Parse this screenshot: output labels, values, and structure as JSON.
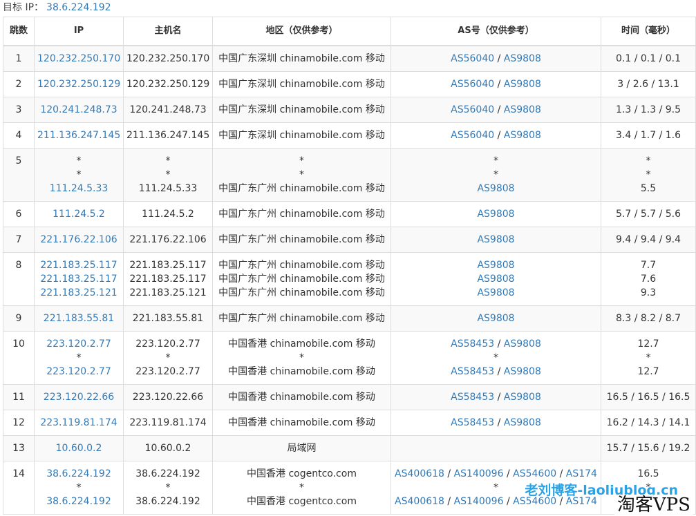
{
  "target": {
    "label": "目标 IP：",
    "ip": "38.6.224.192"
  },
  "headers": [
    "跳数",
    "IP",
    "主机名",
    "地区（仅供参考）",
    "AS号（仅供参考）",
    "时间（毫秒）"
  ],
  "rows": [
    {
      "hop": "1",
      "entries": [
        {
          "ip": "120.232.250.170",
          "host": "120.232.250.170",
          "region": "中国广东深圳 chinamobile.com 移动",
          "as": [
            "AS56040",
            "AS9808"
          ],
          "time": "0.1 / 0.1 / 0.1"
        }
      ]
    },
    {
      "hop": "2",
      "entries": [
        {
          "ip": "120.232.250.129",
          "host": "120.232.250.129",
          "region": "中国广东深圳 chinamobile.com 移动",
          "as": [
            "AS56040",
            "AS9808"
          ],
          "time": "3 / 2.6 / 13.1"
        }
      ]
    },
    {
      "hop": "3",
      "entries": [
        {
          "ip": "120.241.248.73",
          "host": "120.241.248.73",
          "region": "中国广东深圳 chinamobile.com 移动",
          "as": [
            "AS56040",
            "AS9808"
          ],
          "time": "1.3 / 1.3 / 9.5"
        }
      ]
    },
    {
      "hop": "4",
      "entries": [
        {
          "ip": "211.136.247.145",
          "host": "211.136.247.145",
          "region": "中国广东深圳 chinamobile.com 移动",
          "as": [
            "AS56040",
            "AS9808"
          ],
          "time": "3.4 / 1.7 / 1.6"
        }
      ]
    },
    {
      "hop": "5",
      "entries": [
        {
          "ip": "*",
          "host": "*",
          "region": "*",
          "as": [
            "*"
          ],
          "time": "*"
        },
        {
          "ip": "*",
          "host": "*",
          "region": "*",
          "as": [
            "*"
          ],
          "time": "*"
        },
        {
          "ip": "111.24.5.33",
          "host": "111.24.5.33",
          "region": "中国广东广州 chinamobile.com 移动",
          "as": [
            "AS9808"
          ],
          "time": "5.5"
        }
      ]
    },
    {
      "hop": "6",
      "entries": [
        {
          "ip": "111.24.5.2",
          "host": "111.24.5.2",
          "region": "中国广东广州 chinamobile.com 移动",
          "as": [
            "AS9808"
          ],
          "time": "5.7 / 5.7 / 5.6"
        }
      ]
    },
    {
      "hop": "7",
      "entries": [
        {
          "ip": "221.176.22.106",
          "host": "221.176.22.106",
          "region": "中国广东广州 chinamobile.com 移动",
          "as": [
            "AS9808"
          ],
          "time": "9.4 / 9.4 / 9.4"
        }
      ]
    },
    {
      "hop": "8",
      "entries": [
        {
          "ip": "221.183.25.117",
          "host": "221.183.25.117",
          "region": "中国广东广州 chinamobile.com 移动",
          "as": [
            "AS9808"
          ],
          "time": "7.7"
        },
        {
          "ip": "221.183.25.117",
          "host": "221.183.25.117",
          "region": "中国广东广州 chinamobile.com 移动",
          "as": [
            "AS9808"
          ],
          "time": "7.6"
        },
        {
          "ip": "221.183.25.121",
          "host": "221.183.25.121",
          "region": "中国广东广州 chinamobile.com 移动",
          "as": [
            "AS9808"
          ],
          "time": "9.3"
        }
      ]
    },
    {
      "hop": "9",
      "entries": [
        {
          "ip": "221.183.55.81",
          "host": "221.183.55.81",
          "region": "中国广东广州 chinamobile.com 移动",
          "as": [
            "AS9808"
          ],
          "time": "8.3 / 8.2 / 8.7"
        }
      ]
    },
    {
      "hop": "10",
      "entries": [
        {
          "ip": "223.120.2.77",
          "host": "223.120.2.77",
          "region": "中国香港 chinamobile.com 移动",
          "as": [
            "AS58453",
            "AS9808"
          ],
          "time": "12.7"
        },
        {
          "ip": "*",
          "host": "*",
          "region": "*",
          "as": [
            "*"
          ],
          "time": "*"
        },
        {
          "ip": "223.120.2.77",
          "host": "223.120.2.77",
          "region": "中国香港 chinamobile.com 移动",
          "as": [
            "AS58453",
            "AS9808"
          ],
          "time": "12.7"
        }
      ]
    },
    {
      "hop": "11",
      "entries": [
        {
          "ip": "223.120.22.66",
          "host": "223.120.22.66",
          "region": "中国香港 chinamobile.com 移动",
          "as": [
            "AS58453",
            "AS9808"
          ],
          "time": "16.5 / 16.5 / 16.5"
        }
      ]
    },
    {
      "hop": "12",
      "entries": [
        {
          "ip": "223.119.81.174",
          "host": "223.119.81.174",
          "region": "中国香港 chinamobile.com 移动",
          "as": [
            "AS58453",
            "AS9808"
          ],
          "time": "16.2 / 14.3 / 14.1"
        }
      ]
    },
    {
      "hop": "13",
      "entries": [
        {
          "ip": "10.60.0.2",
          "host": "10.60.0.2",
          "region": "局域网",
          "as": [],
          "time": "15.7 / 15.6 / 19.2"
        }
      ]
    },
    {
      "hop": "14",
      "entries": [
        {
          "ip": "38.6.224.192",
          "host": "38.6.224.192",
          "region": "中国香港 cogentco.com",
          "as": [
            "AS400618",
            "AS140096",
            "AS54600",
            "AS174"
          ],
          "time": "16.5"
        },
        {
          "ip": "*",
          "host": "*",
          "region": "*",
          "as": [
            "*"
          ],
          "time": "*"
        },
        {
          "ip": "38.6.224.192",
          "host": "38.6.224.192",
          "region": "中国香港 cogentco.com",
          "as": [
            "AS400618",
            "AS140096",
            "AS54600",
            "AS174"
          ],
          "time": ""
        }
      ]
    }
  ],
  "watermarks": {
    "blog": "老刘博客-laoliublog.cn",
    "brand": "淘客VPS"
  }
}
